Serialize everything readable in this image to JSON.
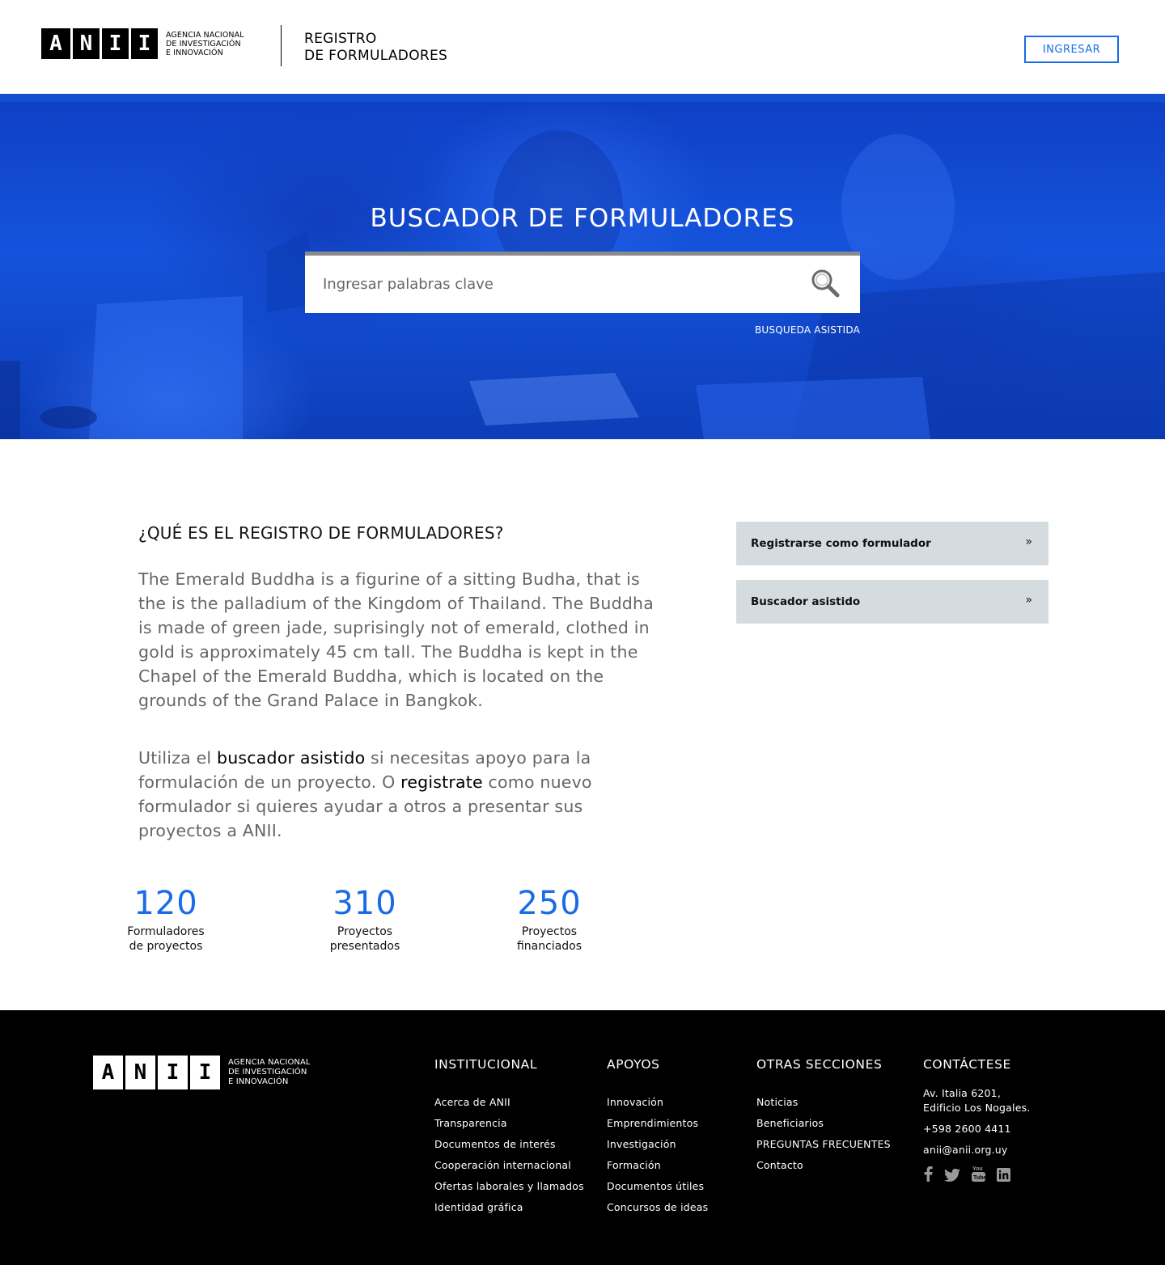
{
  "header": {
    "logo_letters": [
      "A",
      "N",
      "I",
      "I"
    ],
    "logo_text": [
      "AGENCIA NACIONAL",
      "DE INVESTIGACIÓN",
      "E INNOVACIÓN"
    ],
    "title_line1": "REGISTRO",
    "title_line2": "DE FORMULADORES",
    "login_label": "INGRESAR"
  },
  "hero": {
    "title": "BUSCADOR DE FORMULADORES",
    "search_placeholder": "Ingresar palabras clave",
    "assisted_link": "BUSQUEDA ASISTIDA",
    "search_icon": "search-icon"
  },
  "main": {
    "heading": "¿QUÉ ES EL REGISTRO DE FORMULADORES?",
    "paragraph": "The Emerald Buddha is a figurine of a sitting Budha, that is the is the palladium of the Kingdom of Thailand. The Buddha is made of green jade, suprisingly not of emerald, clothed in gold is approximately 45 cm tall. The Buddha is kept in the Chapel of the Emerald Buddha, which is located on the grounds of the Grand Palace in Bangkok.",
    "para2_part1": "Utiliza el ",
    "para2_link1": "buscador asistido",
    "para2_part2": " si necesitas apoyo para la formulación de un proyecto. O ",
    "para2_link2": "registrate",
    "para2_part3": " como nuevo formulador si quieres ayudar a otros a presentar sus proyectos a ANII.",
    "stats": [
      {
        "value": "120",
        "label_line1": "Formuladores",
        "label_line2": "de proyectos"
      },
      {
        "value": "310",
        "label_line1": "Proyectos",
        "label_line2": "presentados"
      },
      {
        "value": "250",
        "label_line1": "Proyectos",
        "label_line2": "financiados"
      }
    ],
    "side_buttons": [
      {
        "label": "Registrarse como formulador",
        "chevron": "»"
      },
      {
        "label": "Buscador asistido",
        "chevron": "»"
      }
    ]
  },
  "footer": {
    "logo_letters": [
      "A",
      "N",
      "I",
      "I"
    ],
    "logo_text": [
      "AGENCIA NACIONAL",
      "DE INVESTIGACIÓN",
      "E INNOVACIÓN"
    ],
    "institucional": {
      "title": "INSTITUCIONAL",
      "items": [
        "Acerca de ANII",
        "Transparencia",
        "Documentos de interés",
        "Cooperación internacional",
        "Ofertas laborales y llamados",
        "Identidad gráfica"
      ]
    },
    "apoyos": {
      "title": "APOYOS",
      "items": [
        "Innovación",
        "Emprendimientos",
        "Investigación",
        "Formación",
        "Documentos útiles",
        "Concursos de ideas"
      ]
    },
    "otras": {
      "title": "OTRAS SECCIONES",
      "items": [
        "Noticias",
        "Beneficiarios",
        "PREGUNTAS FRECUENTES",
        "Contacto"
      ]
    },
    "contacto": {
      "title": "CONTÁCTESE",
      "address_line1": "Av. Italia 6201,",
      "address_line2": "Edificio Los Nogales.",
      "phone": "+598 2600 4411",
      "email": "anii@anii.org.uy",
      "social_icons": [
        "facebook-icon",
        "twitter-icon",
        "youtube-icon",
        "linkedin-icon"
      ]
    }
  },
  "colors": {
    "accent": "#1a6be6",
    "hero_blue": "#1553dc",
    "side_button_bg": "#d5dcdf",
    "footer_bg": "#000000"
  }
}
